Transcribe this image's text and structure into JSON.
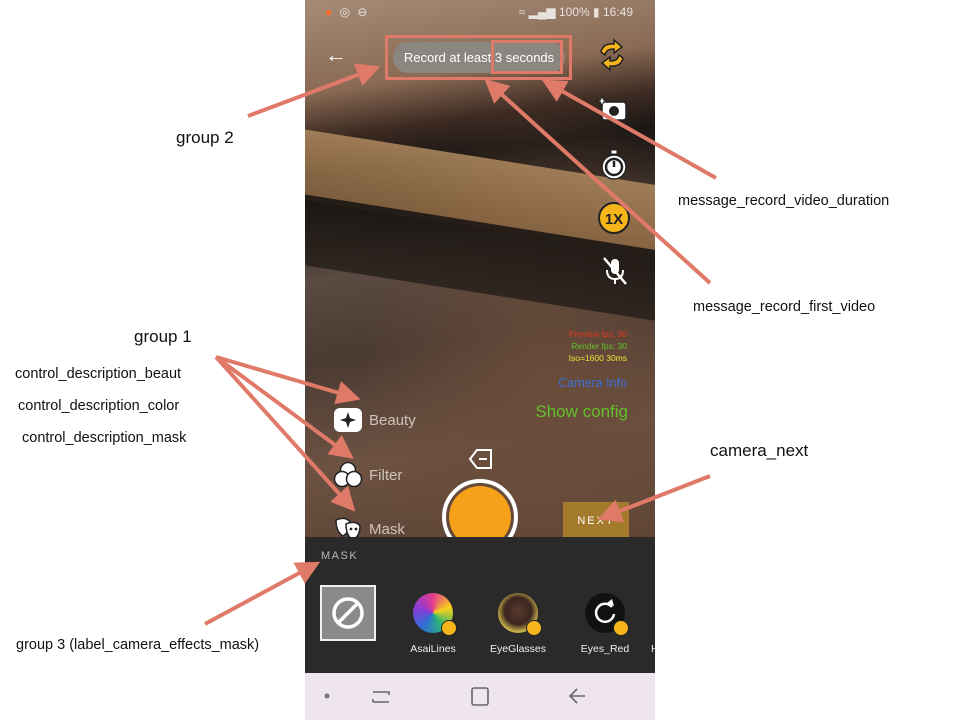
{
  "status_bar": {
    "battery": "100%",
    "time": "16:49"
  },
  "top": {
    "toast_text": "Record at least 3 seconds"
  },
  "debug": {
    "line1": "Preview fps: 30",
    "line2": "Render fps: 30",
    "line3": "Iso=1600  30ms",
    "camera_info": "Camera Info",
    "show_config": "Show config"
  },
  "side_options": {
    "beauty": "Beauty",
    "filter": "Filter",
    "mask": "Mask"
  },
  "next_label": "NEXT",
  "effects_panel": {
    "title": "MASK",
    "items": [
      {
        "label": "AsaiLines"
      },
      {
        "label": "EyeGlasses"
      },
      {
        "label": "Eyes_Red"
      },
      {
        "label": "H"
      }
    ]
  },
  "annotations": {
    "group2": "group 2",
    "group1": "group 1",
    "beaut": "control_description_beaut",
    "color": "control_description_color",
    "mask": "control_description_mask",
    "group3": "group 3 (label_camera_effects_mask)",
    "duration": "message_record_video_duration",
    "first_video": "message_record_first_video",
    "camera_next": "camera_next"
  },
  "colors": {
    "annotation_arrow": "#e07a68",
    "shutter": "#f6a11a",
    "next_button": "#a47a2c",
    "show_config": "#62c12a",
    "camera_info": "#3a6fd6"
  }
}
